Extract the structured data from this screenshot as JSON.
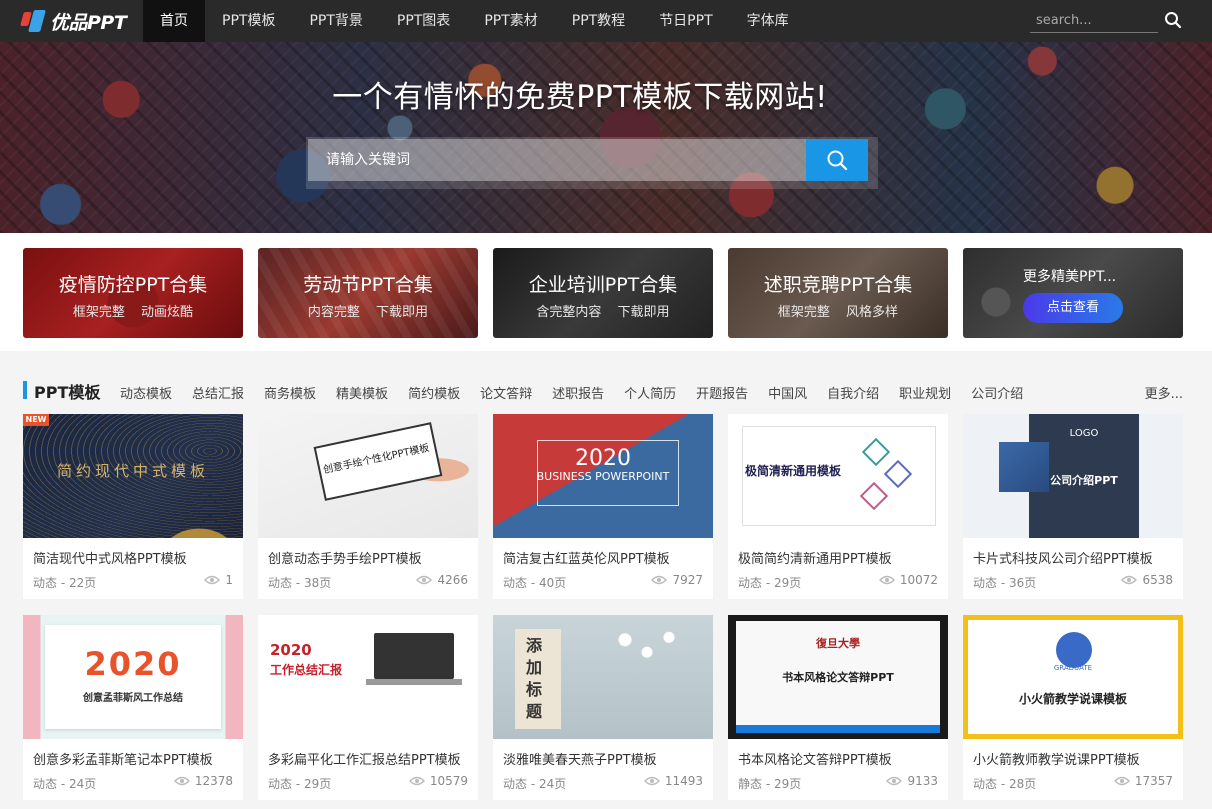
{
  "nav": {
    "logo_text": "优品PPT",
    "items": [
      {
        "label": "首页",
        "active": true
      },
      {
        "label": "PPT模板"
      },
      {
        "label": "PPT背景"
      },
      {
        "label": "PPT图表"
      },
      {
        "label": "PPT素材"
      },
      {
        "label": "PPT教程"
      },
      {
        "label": "节日PPT"
      },
      {
        "label": "字体库"
      }
    ],
    "search_placeholder": "search..."
  },
  "hero": {
    "title": "一个有情怀的免费PPT模板下载网站!",
    "search_placeholder": "请输入关键词"
  },
  "features": [
    {
      "title": "疫情防控PPT合集",
      "sub": "框架完整 动画炫酷"
    },
    {
      "title": "劳动节PPT合集",
      "sub": "内容完整 下载即用"
    },
    {
      "title": "企业培训PPT合集",
      "sub": "含完整内容 下载即用"
    },
    {
      "title": "述职竞聘PPT合集",
      "sub": "框架完整 风格多样"
    },
    {
      "title": "更多精美PPT...",
      "button": "点击查看"
    }
  ],
  "section": {
    "title": "PPT模板",
    "categories": [
      "动态模板",
      "总结汇报",
      "商务模板",
      "精美模板",
      "简约模板",
      "论文答辩",
      "述职报告",
      "个人简历",
      "开题报告",
      "中国风",
      "自我介绍",
      "职业规划",
      "公司介绍"
    ],
    "more": "更多..."
  },
  "cards": [
    {
      "title": "简洁现代中式风格PPT模板",
      "meta": "动态 - 22页",
      "views": "1",
      "badge": "NEW",
      "thumb_text": "简约现代中式模板"
    },
    {
      "title": "创意动态手势手绘PPT模板",
      "meta": "动态 - 38页",
      "views": "4266",
      "thumb_text": "创意手绘个性化PPT模板"
    },
    {
      "title": "简洁复古红蓝英伦风PPT模板",
      "meta": "动态 - 40页",
      "views": "7927",
      "thumb_text": "2020",
      "thumb_text2": "BUSINESS POWERPOINT"
    },
    {
      "title": "极简简约清新通用PPT模板",
      "meta": "动态 - 29页",
      "views": "10072",
      "thumb_text": "极简清新通用模板"
    },
    {
      "title": "卡片式科技风公司介绍PPT模板",
      "meta": "动态 - 36页",
      "views": "6538",
      "thumb_text": "公司介绍PPT",
      "thumb_text2": "LOGO"
    },
    {
      "title": "创意多彩孟菲斯笔记本PPT模板",
      "meta": "动态 - 24页",
      "views": "12378",
      "thumb_text": "2020",
      "thumb_text2": "创意孟菲斯风工作总结"
    },
    {
      "title": "多彩扁平化工作汇报总结PPT模板",
      "meta": "动态 - 29页",
      "views": "10579",
      "thumb_text": "2020",
      "thumb_text2": "工作总结汇报"
    },
    {
      "title": "淡雅唯美春天燕子PPT模板",
      "meta": "动态 - 24页",
      "views": "11493",
      "thumb_text": "添加标题"
    },
    {
      "title": "书本风格论文答辩PPT模板",
      "meta": "静态 - 29页",
      "views": "9133",
      "thumb_text": "书本风格论文答辩PPT",
      "thumb_text2": "復旦大學"
    },
    {
      "title": "小火箭教师教学说课PPT模板",
      "meta": "动态 - 28页",
      "views": "17357",
      "thumb_text": "小火箭教学说课模板",
      "thumb_text2": "GRADUATE"
    }
  ],
  "colors": {
    "accent": "#1a96e6",
    "nav_bg": "#2a2a2a",
    "badge": "#e8532a"
  }
}
